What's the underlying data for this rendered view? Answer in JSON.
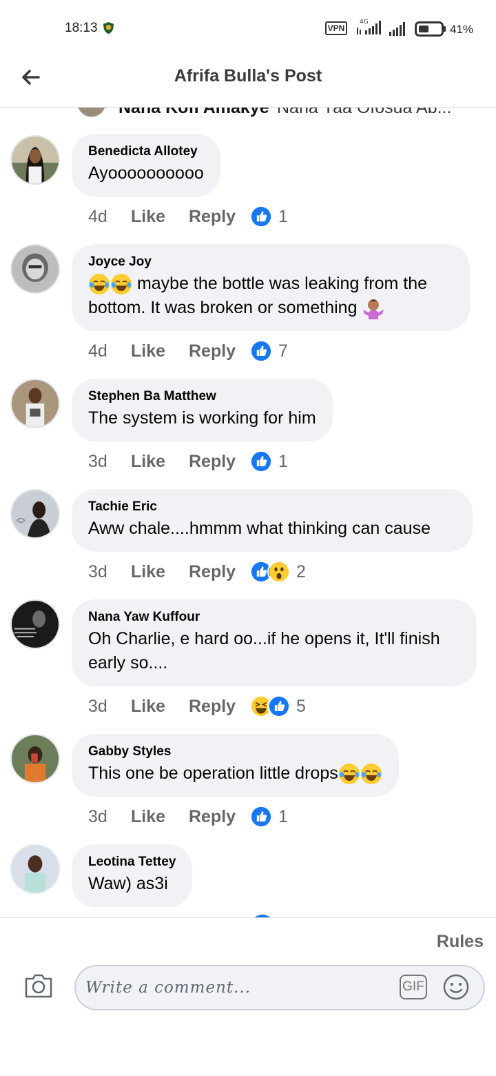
{
  "status_bar": {
    "time": "18:13",
    "vpn": "VPN",
    "network": "4G",
    "battery": "41%"
  },
  "header": {
    "title": "Afrifa Bulla's Post",
    "back_icon": "arrow-left-icon"
  },
  "clipped_comment": {
    "author": "Nana Kofi Amakye",
    "text": "Nana Yaa Ofosua Ab..."
  },
  "comments": [
    {
      "author": "Benedicta Allotey",
      "text": "Ayoooooooooo",
      "time": "4d",
      "like": "Like",
      "reply": "Reply",
      "reactions": [
        "like"
      ],
      "count": "1"
    },
    {
      "author": "Joyce Joy",
      "text": "maybe the bottle was leaking from the bottom. It was broken or something",
      "time": "4d",
      "like": "Like",
      "reply": "Reply",
      "reactions": [
        "like"
      ],
      "count": "7"
    },
    {
      "author": "Stephen Ba Matthew",
      "text": "The system is working for him",
      "time": "3d",
      "like": "Like",
      "reply": "Reply",
      "reactions": [
        "like"
      ],
      "count": "1"
    },
    {
      "author": "Tachie Eric",
      "text": "Aww chale....hmmm what thinking can cause",
      "time": "3d",
      "like": "Like",
      "reply": "Reply",
      "reactions": [
        "like",
        "wow"
      ],
      "count": "2"
    },
    {
      "author": "Nana Yaw Kuffour",
      "text": "Oh Charlie, e hard oo...if he opens it, It'll finish early so....",
      "time": "3d",
      "like": "Like",
      "reply": "Reply",
      "reactions": [
        "haha",
        "like"
      ],
      "count": "5"
    },
    {
      "author": "Gabby Styles",
      "text": "This one be operation little drops",
      "time": "3d",
      "like": "Like",
      "reply": "Reply",
      "reactions": [
        "like"
      ],
      "count": "1"
    },
    {
      "author": "Leotina Tettey",
      "text": "Waw) as3i",
      "time": "",
      "like": "",
      "reply": "",
      "reactions": [],
      "count": ""
    }
  ],
  "footer": {
    "rules": "Rules",
    "placeholder": "Write a comment...",
    "gif": "GIF"
  },
  "colors": {
    "like_blue": "#1877f2",
    "bubble_bg": "#f0f2f5",
    "meta_gray": "#65676b",
    "emoji_yellow": "#ffcc33"
  }
}
